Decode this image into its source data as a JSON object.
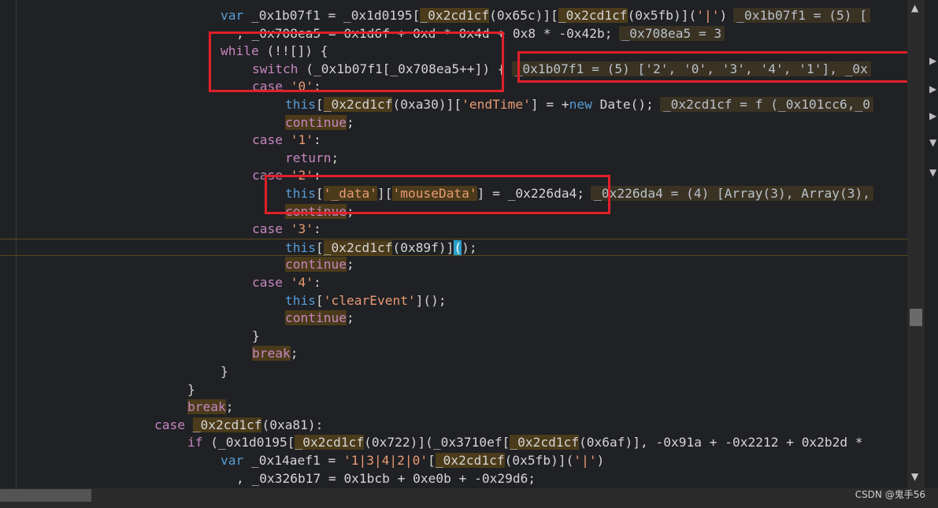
{
  "colors": {
    "background": "#202124",
    "keyword": "#c586c0",
    "string": "#e89a74",
    "identifier": "#d4d4d4",
    "token_highlight": "#4b3b1a",
    "inline_value": "#b9c2cc",
    "annotation_box": "#e0202a",
    "caret": "#2aa0c8"
  },
  "icons": [
    "scroll-up-arrow-icon",
    "scroll-down-arrow-icon",
    "side-arrow-icon",
    "expand-triangle-icon"
  ],
  "watermark": "CSDN @鬼手56",
  "code_lines": [
    {
      "indent": 280,
      "tokens": [
        {
          "t": "var",
          "c": "kwb"
        },
        {
          "t": " _0x1b07f1 = _0x1d0195[",
          "c": "pl"
        },
        {
          "t": "_0x2cd1cf",
          "c": "hl"
        },
        {
          "t": "(0x65c)][",
          "c": "pl"
        },
        {
          "t": "_0x2cd1cf",
          "c": "hl"
        },
        {
          "t": "(0x5fb)](",
          "c": "pl"
        },
        {
          "t": "'|'",
          "c": "str"
        },
        {
          "t": ")",
          "c": "pl"
        }
      ],
      "inline": "_0x1b07f1 = (5) ["
    },
    {
      "indent": 300,
      "tokens": [
        {
          "t": ", _0x708ea5 = 0x1d6f + 0xd * 0x4d + 0x8 * -0x42b;",
          "c": "pl"
        }
      ],
      "inline": "_0x708ea5 = 3"
    },
    {
      "indent": 280,
      "tokens": [
        {
          "t": "while",
          "c": "kw"
        },
        {
          "t": " (!![]) {",
          "c": "pl"
        }
      ],
      "inline": ""
    },
    {
      "indent": 320,
      "tokens": [
        {
          "t": "switch",
          "c": "kw"
        },
        {
          "t": " (_0x1b07f1[_0x708ea5++]) {",
          "c": "pl"
        }
      ],
      "inline": "_0x1b07f1 = (5) ['2', '0', '3', '4', '1'], _0x"
    },
    {
      "indent": 320,
      "tokens": [
        {
          "t": "case",
          "c": "kw"
        },
        {
          "t": " ",
          "c": "pl"
        },
        {
          "t": "'0'",
          "c": "str"
        },
        {
          "t": ":",
          "c": "pl"
        }
      ],
      "inline": ""
    },
    {
      "indent": 362,
      "tokens": [
        {
          "t": "this",
          "c": "kwb"
        },
        {
          "t": "[",
          "c": "pl"
        },
        {
          "t": "_0x2cd1cf",
          "c": "hl"
        },
        {
          "t": "(0xa30)][",
          "c": "pl"
        },
        {
          "t": "'endTime'",
          "c": "str"
        },
        {
          "t": "] = +",
          "c": "pl"
        },
        {
          "t": "new",
          "c": "kwb"
        },
        {
          "t": " Date();",
          "c": "pl"
        }
      ],
      "inline": "_0x2cd1cf = f (_0x101cc6,_0"
    },
    {
      "indent": 362,
      "tokens": [
        {
          "t": "continue",
          "c": "kwhl"
        },
        {
          "t": ";",
          "c": "pl"
        }
      ],
      "inline": ""
    },
    {
      "indent": 320,
      "tokens": [
        {
          "t": "case",
          "c": "kw"
        },
        {
          "t": " ",
          "c": "pl"
        },
        {
          "t": "'1'",
          "c": "str"
        },
        {
          "t": ":",
          "c": "pl"
        }
      ],
      "inline": ""
    },
    {
      "indent": 362,
      "tokens": [
        {
          "t": "return",
          "c": "kw"
        },
        {
          "t": ";",
          "c": "pl"
        }
      ],
      "inline": ""
    },
    {
      "indent": 320,
      "tokens": [
        {
          "t": "case",
          "c": "kw"
        },
        {
          "t": " ",
          "c": "pl"
        },
        {
          "t": "'2'",
          "c": "str"
        },
        {
          "t": ":",
          "c": "pl"
        }
      ],
      "inline": ""
    },
    {
      "indent": 362,
      "tokens": [
        {
          "t": "this",
          "c": "kwb"
        },
        {
          "t": "[",
          "c": "pl"
        },
        {
          "t": "'_data'",
          "c": "strhl"
        },
        {
          "t": "][",
          "c": "pl"
        },
        {
          "t": "'mouseData'",
          "c": "strhl"
        },
        {
          "t": "] = _0x226da4;",
          "c": "pl"
        }
      ],
      "inline": "_0x226da4 = (4) [Array(3), Array(3),"
    },
    {
      "indent": 362,
      "tokens": [
        {
          "t": "continue",
          "c": "kwhl"
        },
        {
          "t": ";",
          "c": "pl"
        }
      ],
      "inline": ""
    },
    {
      "indent": 320,
      "tokens": [
        {
          "t": "case",
          "c": "kw"
        },
        {
          "t": " ",
          "c": "pl"
        },
        {
          "t": "'3'",
          "c": "str"
        },
        {
          "t": ":",
          "c": "pl"
        }
      ],
      "inline": ""
    },
    {
      "indent": 362,
      "paused": true,
      "tokens": [
        {
          "t": "this",
          "c": "kwb"
        },
        {
          "t": "[",
          "c": "pl"
        },
        {
          "t": "_0x2cd1cf",
          "c": "hl"
        },
        {
          "t": "(0x89f)]",
          "c": "pl"
        },
        {
          "t": "(",
          "c": "caret"
        },
        {
          "t": ");",
          "c": "pl"
        }
      ],
      "inline": ""
    },
    {
      "indent": 362,
      "tokens": [
        {
          "t": "continue",
          "c": "kwhl"
        },
        {
          "t": ";",
          "c": "pl"
        }
      ],
      "inline": ""
    },
    {
      "indent": 320,
      "tokens": [
        {
          "t": "case",
          "c": "kw"
        },
        {
          "t": " ",
          "c": "pl"
        },
        {
          "t": "'4'",
          "c": "str"
        },
        {
          "t": ":",
          "c": "pl"
        }
      ],
      "inline": ""
    },
    {
      "indent": 362,
      "tokens": [
        {
          "t": "this",
          "c": "kwb"
        },
        {
          "t": "[",
          "c": "pl"
        },
        {
          "t": "'clearEvent'",
          "c": "str"
        },
        {
          "t": "]();",
          "c": "pl"
        }
      ],
      "inline": ""
    },
    {
      "indent": 362,
      "tokens": [
        {
          "t": "continue",
          "c": "kwhl"
        },
        {
          "t": ";",
          "c": "pl"
        }
      ],
      "inline": ""
    },
    {
      "indent": 320,
      "tokens": [
        {
          "t": "}",
          "c": "pl"
        }
      ],
      "inline": ""
    },
    {
      "indent": 320,
      "tokens": [
        {
          "t": "break",
          "c": "kwhl"
        },
        {
          "t": ";",
          "c": "pl"
        }
      ],
      "inline": ""
    },
    {
      "indent": 280,
      "tokens": [
        {
          "t": "}",
          "c": "pl"
        }
      ],
      "inline": ""
    },
    {
      "indent": 238,
      "tokens": [
        {
          "t": "}",
          "c": "pl"
        }
      ],
      "inline": ""
    },
    {
      "indent": 238,
      "tokens": [
        {
          "t": "break",
          "c": "kwhl"
        },
        {
          "t": ";",
          "c": "pl"
        }
      ],
      "inline": ""
    },
    {
      "indent": 196,
      "tokens": [
        {
          "t": "case",
          "c": "kw"
        },
        {
          "t": " ",
          "c": "pl"
        },
        {
          "t": "_0x2cd1cf",
          "c": "hl"
        },
        {
          "t": "(0xa81):",
          "c": "pl"
        }
      ],
      "inline": ""
    },
    {
      "indent": 238,
      "tokens": [
        {
          "t": "if",
          "c": "kw"
        },
        {
          "t": " (_0x1d0195[",
          "c": "pl"
        },
        {
          "t": "_0x2cd1cf",
          "c": "hl"
        },
        {
          "t": "(0x722)](_0x3710ef[",
          "c": "pl"
        },
        {
          "t": "_0x2cd1cf",
          "c": "hl"
        },
        {
          "t": "(0x6af)], -0x91a + -0x2212 + 0x2b2d *",
          "c": "pl"
        }
      ],
      "inline": ""
    },
    {
      "indent": 280,
      "tokens": [
        {
          "t": "var",
          "c": "kwb"
        },
        {
          "t": " _0x14aef1 = ",
          "c": "pl"
        },
        {
          "t": "'1|3|4|2|0'",
          "c": "str"
        },
        {
          "t": "[",
          "c": "pl"
        },
        {
          "t": "_0x2cd1cf",
          "c": "hl"
        },
        {
          "t": "(0x5fb)](",
          "c": "pl"
        },
        {
          "t": "'|'",
          "c": "str"
        },
        {
          "t": ")",
          "c": "pl"
        }
      ],
      "inline": ""
    },
    {
      "indent": 300,
      "tokens": [
        {
          "t": ", _0x326b17 = 0x1bcb + 0xe0b + -0x29d6;",
          "c": "pl"
        }
      ],
      "inline": ""
    }
  ]
}
